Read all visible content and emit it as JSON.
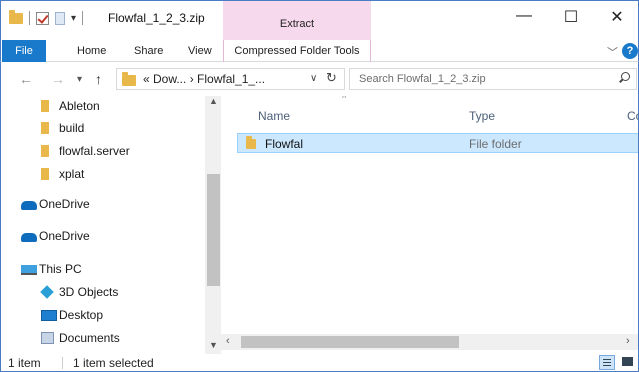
{
  "window": {
    "title": "Flowfal_1_2_3.zip",
    "context_tab_group": "Extract",
    "controls": {
      "minimize": "—",
      "maximize": "☐",
      "close": "✕"
    }
  },
  "ribbon": {
    "tabs": {
      "file": "File",
      "home": "Home",
      "share": "Share",
      "view": "View",
      "compressed": "Compressed Folder Tools"
    },
    "help": "?"
  },
  "address": {
    "path_display": "« Dow... › Flowfal_1_...",
    "search_placeholder": "Search Flowfal_1_2_3.zip"
  },
  "nav_pane": {
    "items": [
      {
        "label": "Ableton",
        "icon": "folder-icon"
      },
      {
        "label": "build",
        "icon": "folder-icon"
      },
      {
        "label": "flowfal.server",
        "icon": "folder-icon"
      },
      {
        "label": "xplat",
        "icon": "folder-icon"
      },
      {
        "label": "OneDrive",
        "icon": "onedrive-icon"
      },
      {
        "label": "OneDrive",
        "icon": "onedrive-icon"
      },
      {
        "label": "This PC",
        "icon": "this-pc-icon"
      },
      {
        "label": "3D Objects",
        "icon": "3d-objects-icon"
      },
      {
        "label": "Desktop",
        "icon": "desktop-icon"
      },
      {
        "label": "Documents",
        "icon": "documents-icon"
      }
    ]
  },
  "content": {
    "columns": {
      "name": "Name",
      "type": "Type",
      "compressed": "Co"
    },
    "rows": [
      {
        "name": "Flowfal",
        "type": "File folder",
        "selected": true
      }
    ]
  },
  "status": {
    "count": "1 item",
    "selection": "1 item selected"
  },
  "colors": {
    "accent": "#1979ca",
    "selection": "#cce8ff",
    "context_tab": "#f7d9ed",
    "window_border": "#4a7cc4"
  }
}
